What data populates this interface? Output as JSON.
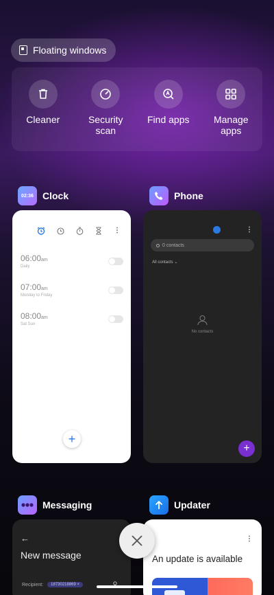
{
  "floating_windows": {
    "label": "Floating windows",
    "icon": "floating-window-icon"
  },
  "tools": [
    {
      "label": "Cleaner",
      "icon": "trash-icon"
    },
    {
      "label": "Security scan",
      "icon": "shield-check-icon"
    },
    {
      "label": "Find apps",
      "icon": "find-apps-icon"
    },
    {
      "label": "Manage apps",
      "icon": "grid-icon"
    }
  ],
  "apps": {
    "clock": {
      "name": "Clock",
      "icon_time": "02:36",
      "alarms": [
        {
          "time": "06:00",
          "ampm": "am",
          "repeat": "Daily"
        },
        {
          "time": "07:00",
          "ampm": "am",
          "repeat": "Monday to Friday"
        },
        {
          "time": "08:00",
          "ampm": "am",
          "repeat": "Sat Sun"
        }
      ],
      "add": "+"
    },
    "phone": {
      "name": "Phone",
      "search_placeholder": "0 contacts",
      "filter": "All contacts",
      "empty": "No contacts",
      "add": "+"
    },
    "messaging": {
      "name": "Messaging",
      "back": "←",
      "title": "New message",
      "recipient_label": "Recipient:",
      "recipient_value": "18730218869",
      "recipient_remove": "×"
    },
    "updater": {
      "name": "Updater",
      "title": "An update is available"
    }
  },
  "colors": {
    "accent_blue": "#2a7ae2",
    "accent_purple": "#7a2fd0"
  }
}
